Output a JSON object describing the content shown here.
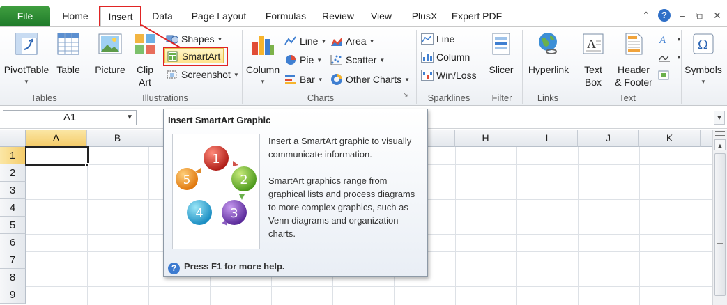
{
  "tabs": [
    {
      "label": "File"
    },
    {
      "label": "Home"
    },
    {
      "label": "Insert"
    },
    {
      "label": "Data"
    },
    {
      "label": "Page Layout"
    },
    {
      "label": "Formulas"
    },
    {
      "label": "Review"
    },
    {
      "label": "View"
    },
    {
      "label": "PlusX"
    },
    {
      "label": "Expert PDF"
    }
  ],
  "window_controls": [
    "chevron-up-icon",
    "help-icon",
    "minimize-icon",
    "restore-icon",
    "close-icon"
  ],
  "ribbon": {
    "tables": {
      "label": "Tables",
      "pivot_table": "PivotTable",
      "table": "Table"
    },
    "illustrations": {
      "label": "Illustrations",
      "picture": "Picture",
      "clip_art_1": "Clip",
      "clip_art_2": "Art",
      "shapes": "Shapes",
      "smartart": "SmartArt",
      "screenshot": "Screenshot"
    },
    "charts": {
      "label": "Charts",
      "column": "Column",
      "line": "Line",
      "pie": "Pie",
      "bar": "Bar",
      "area": "Area",
      "scatter": "Scatter",
      "other": "Other Charts"
    },
    "sparklines": {
      "label": "Sparklines",
      "line": "Line",
      "column": "Column",
      "winloss": "Win/Loss"
    },
    "filter": {
      "label": "Filter",
      "slicer": "Slicer"
    },
    "links": {
      "label": "Links",
      "hyperlink": "Hyperlink"
    },
    "text": {
      "label": "Text",
      "textbox_1": "Text",
      "textbox_2": "Box",
      "header_1": "Header",
      "header_2": "& Footer"
    },
    "symbols": {
      "label": "Symbols",
      "symbols": "Symbols"
    }
  },
  "formula_bar": {
    "name_box": "A1"
  },
  "grid": {
    "columns": [
      "A",
      "B",
      "",
      "",
      "",
      "",
      "",
      "H",
      "I",
      "J",
      "K"
    ],
    "rows": [
      "1",
      "2",
      "3",
      "4",
      "5",
      "6",
      "7",
      "8",
      "9"
    ],
    "active_cell": "A1"
  },
  "tooltip": {
    "title": "Insert SmartArt Graphic",
    "para1": "Insert a SmartArt graphic to visually communicate information.",
    "para2": "SmartArt graphics range from graphical lists and process diagrams to more complex graphics, such as Venn diagrams and organization charts.",
    "help": "Press F1 for more help.",
    "steps": [
      "1",
      "2",
      "3",
      "4",
      "5"
    ]
  },
  "colors": {
    "file_tab": "#2a8a35",
    "highlight": "#e02424",
    "active_header": "#f5cc6a"
  }
}
